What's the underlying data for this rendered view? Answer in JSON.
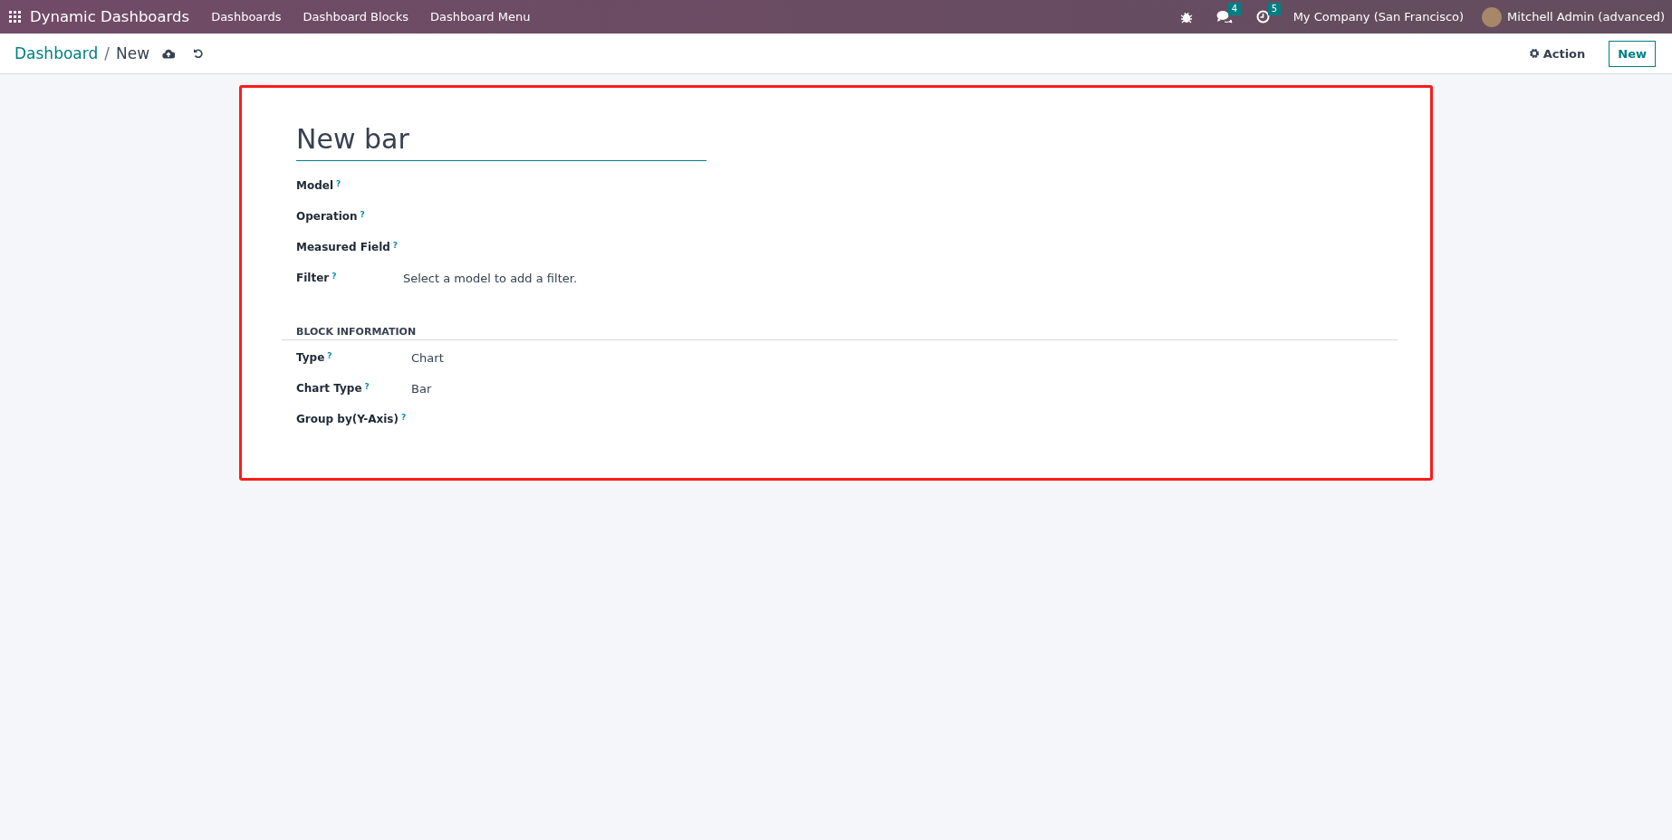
{
  "navbar": {
    "app_name": "Dynamic Dashboards",
    "menus": [
      "Dashboards",
      "Dashboard Blocks",
      "Dashboard Menu"
    ],
    "systray": [
      {
        "kind": "bug"
      },
      {
        "kind": "chat",
        "badge": "4"
      },
      {
        "kind": "clock",
        "badge": "5"
      }
    ],
    "company": "My Company (San Francisco)",
    "user": "Mitchell Admin (advanced)"
  },
  "control_panel": {
    "breadcrumb": [
      "Dashboard",
      "New"
    ],
    "separator": "/",
    "action": "Action",
    "new_button": "New"
  },
  "form": {
    "highlighted": true,
    "title": "New bar",
    "fields": [
      {
        "label": "Model",
        "help": "?"
      },
      {
        "label": "Operation",
        "help": "?"
      },
      {
        "label": "Measured Field",
        "help": "?"
      },
      {
        "label": "Filter",
        "help": "?",
        "value": "Select a model to add a filter."
      }
    ],
    "section": "BLOCK INFORMATION",
    "section_fields": [
      {
        "label": "Type",
        "help": "?",
        "value": "Chart"
      },
      {
        "label": "Chart Type",
        "help": "?",
        "value": "Bar"
      },
      {
        "label": "Group by(Y-Axis)",
        "help": "?"
      }
    ]
  }
}
